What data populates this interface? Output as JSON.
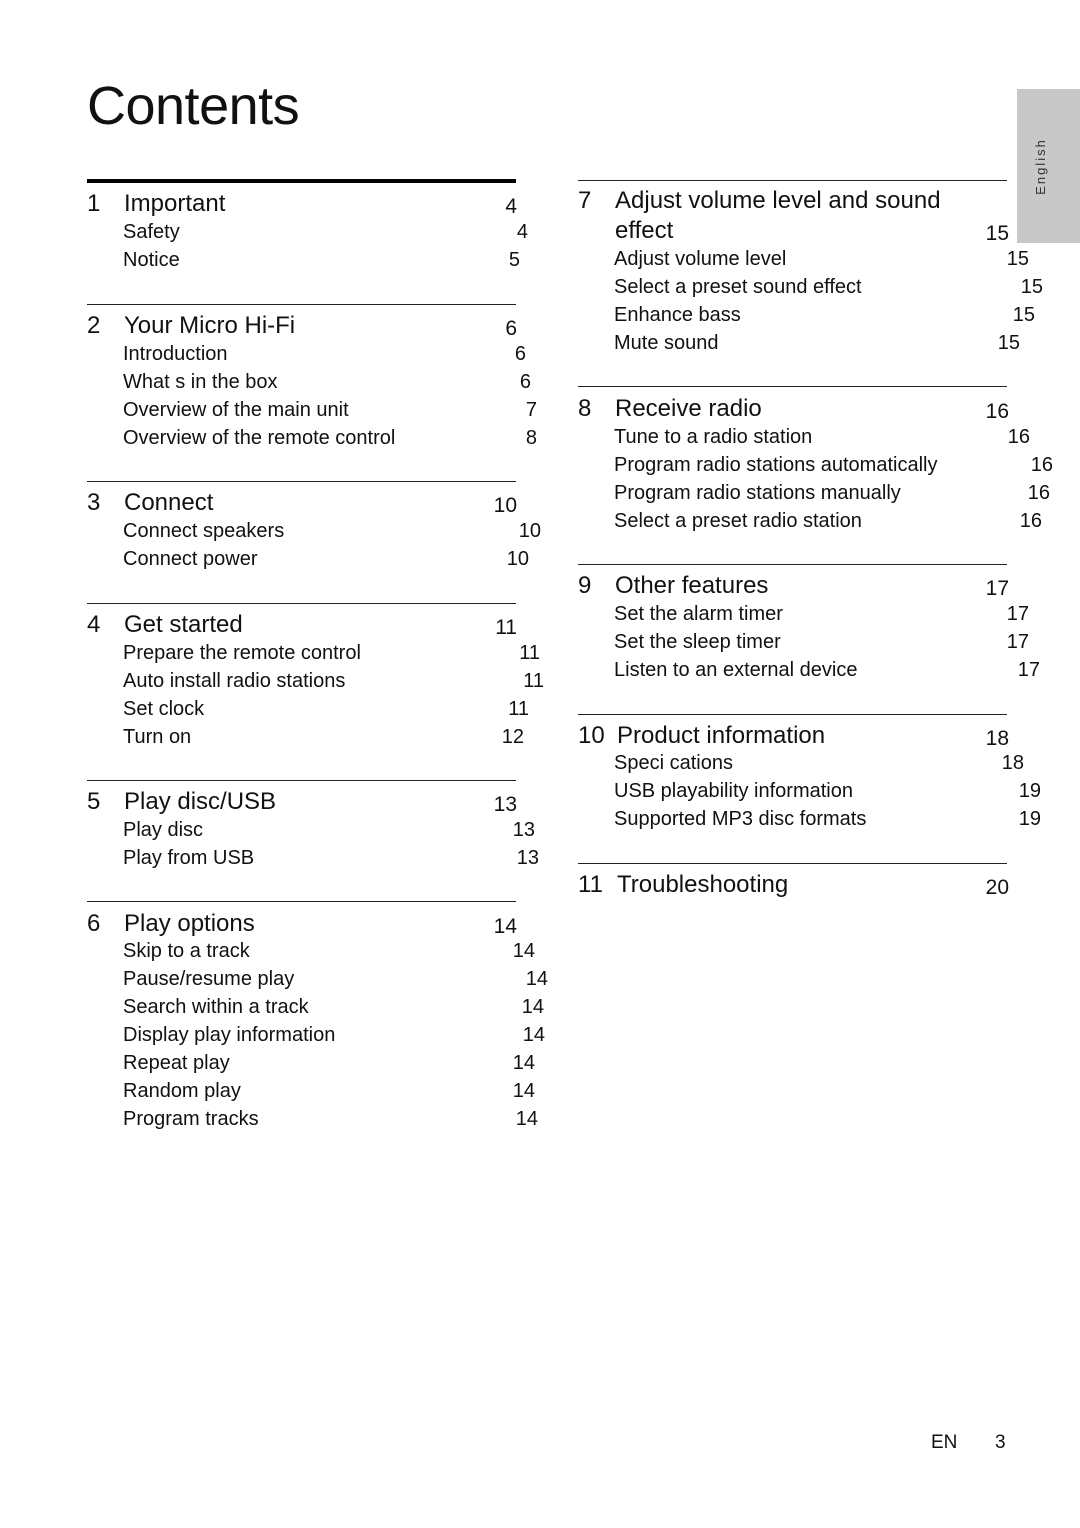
{
  "page": {
    "title": "Contents",
    "language_tab": "English",
    "footer": {
      "lang": "EN",
      "page_number": "3"
    }
  },
  "sections": [
    {
      "number": "1",
      "title": "Important",
      "page": "4",
      "title_cont": "",
      "items": [
        {
          "label": "Safety",
          "page": "4"
        },
        {
          "label": "Notice",
          "page": "5"
        }
      ]
    },
    {
      "number": "2",
      "title": "Your Micro Hi-Fi",
      "page": "6",
      "title_cont": "",
      "items": [
        {
          "label": "Introduction",
          "page": "6"
        },
        {
          "label": "What s in the box",
          "page": "6"
        },
        {
          "label": "Overview of the main unit",
          "page": "7"
        },
        {
          "label": "Overview of the remote control",
          "page": "8"
        }
      ]
    },
    {
      "number": "3",
      "title": "Connect",
      "page": "10",
      "title_cont": "",
      "items": [
        {
          "label": "Connect speakers",
          "page": "10"
        },
        {
          "label": "Connect power",
          "page": "10"
        }
      ]
    },
    {
      "number": "4",
      "title": "Get started",
      "page": "11",
      "title_cont": "",
      "items": [
        {
          "label": "Prepare the remote control",
          "page": "11"
        },
        {
          "label": "Auto install radio stations",
          "page": "11"
        },
        {
          "label": "Set clock",
          "page": "11"
        },
        {
          "label": "Turn on",
          "page": "12"
        }
      ]
    },
    {
      "number": "5",
      "title": "Play disc/USB",
      "page": "13",
      "title_cont": "",
      "items": [
        {
          "label": "Play disc",
          "page": "13"
        },
        {
          "label": "Play from USB",
          "page": "13"
        }
      ]
    },
    {
      "number": "6",
      "title": "Play options",
      "page": "14",
      "title_cont": "",
      "items": [
        {
          "label": "Skip to a track",
          "page": "14"
        },
        {
          "label": "Pause/resume play",
          "page": "14"
        },
        {
          "label": "Search within a track",
          "page": "14"
        },
        {
          "label": "Display play information",
          "page": "14"
        },
        {
          "label": "Repeat play",
          "page": "14"
        },
        {
          "label": "Random play",
          "page": "14"
        },
        {
          "label": "Program tracks",
          "page": "14"
        }
      ]
    },
    {
      "number": "7",
      "title": "Adjust volume level and sound",
      "page": "15",
      "title_cont": "effect",
      "items": [
        {
          "label": "Adjust volume level",
          "page": "15"
        },
        {
          "label": "Select a preset sound effect",
          "page": "15"
        },
        {
          "label": "Enhance bass",
          "page": "15"
        },
        {
          "label": "Mute sound",
          "page": "15"
        }
      ]
    },
    {
      "number": "8",
      "title": "Receive radio",
      "page": "16",
      "title_cont": "",
      "items": [
        {
          "label": "Tune to a radio station",
          "page": "16"
        },
        {
          "label": "Program radio stations automatically",
          "page": "16"
        },
        {
          "label": "Program radio stations manually",
          "page": "16"
        },
        {
          "label": "Select a preset radio station",
          "page": "16"
        }
      ]
    },
    {
      "number": "9",
      "title": "Other features",
      "page": "17",
      "title_cont": "",
      "items": [
        {
          "label": "Set the alarm timer",
          "page": "17"
        },
        {
          "label": "Set the sleep timer",
          "page": "17"
        },
        {
          "label": "Listen to an external device",
          "page": "17"
        }
      ]
    },
    {
      "number": "10",
      "title": "Product information",
      "page": "18",
      "title_cont": "",
      "items": [
        {
          "label": "Speci cations",
          "page": "18"
        },
        {
          "label": "USB playability information",
          "page": "19"
        },
        {
          "label": "Supported MP3 disc formats",
          "page": "19"
        }
      ]
    },
    {
      "number": "11",
      "title": "Troubleshooting",
      "page": "20",
      "title_cont": "",
      "items": []
    }
  ]
}
